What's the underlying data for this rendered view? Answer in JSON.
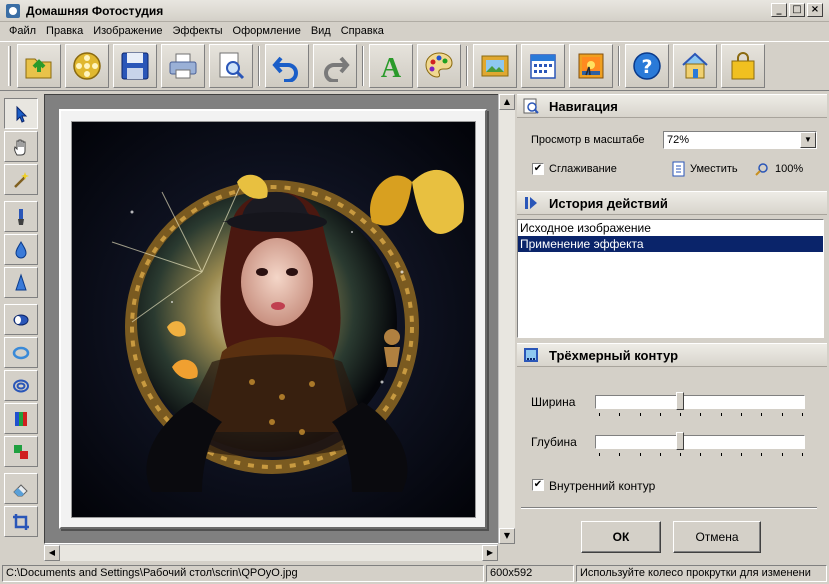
{
  "window": {
    "title": "Домашняя Фотостудия",
    "controls": [
      "_",
      "□",
      "×"
    ]
  },
  "menu": [
    "Файл",
    "Правка",
    "Изображение",
    "Эффекты",
    "Оформление",
    "Вид",
    "Справка"
  ],
  "toolbar": {
    "buttons": [
      {
        "name": "open-icon"
      },
      {
        "name": "film-reel-icon"
      },
      {
        "name": "save-icon"
      },
      {
        "name": "print-icon"
      },
      {
        "name": "preview-icon"
      },
      {
        "name": "undo-icon"
      },
      {
        "name": "redo-icon"
      },
      {
        "name": "text-icon"
      },
      {
        "name": "palette-icon"
      },
      {
        "name": "frame-icon"
      },
      {
        "name": "calendar-icon"
      },
      {
        "name": "postcard-icon"
      },
      {
        "name": "help-icon"
      },
      {
        "name": "home-icon"
      },
      {
        "name": "shop-icon"
      }
    ],
    "text_glyph": "A",
    "help_glyph": "?"
  },
  "left_tools": [
    "pointer-icon",
    "hand-icon",
    "magic-wand-icon",
    "brush-icon",
    "drop-icon",
    "sharpen-icon",
    "ellipse-icon",
    "ring-icon",
    "double-ring-icon",
    "color-levels-icon",
    "color-swap-icon",
    "eraser-icon",
    "crop-icon"
  ],
  "colors": {
    "selection": "#0a246a",
    "face": "#d4d0c8"
  },
  "navigation": {
    "title": "Навигация",
    "scale_label": "Просмотр в масштабе",
    "scale_value": "72%",
    "smoothing_label": "Сглаживание",
    "smoothing_checked": true,
    "fit_label": "Уместить",
    "actual_label": "100%"
  },
  "history": {
    "title": "История действий",
    "items": [
      "Исходное изображение",
      "Применение эффекта"
    ],
    "selected_index": 1
  },
  "contour": {
    "title": "Трёхмерный контур",
    "width_label": "Ширина",
    "width_value": 0.4,
    "depth_label": "Глубина",
    "depth_value": 0.4,
    "inner_label": "Внутренний контур",
    "inner_checked": true,
    "ok_label": "ОК",
    "cancel_label": "Отмена"
  },
  "status": {
    "path": "C:\\Documents and Settings\\Рабочий стол\\scrin\\QPOyO.jpg",
    "size": "600x592",
    "hint": "Используйте колесо прокрутки для изменени"
  },
  "scroll_arrows": {
    "up": "▲",
    "down": "▼",
    "left": "◀",
    "right": "▶"
  },
  "checkmark": "✔"
}
